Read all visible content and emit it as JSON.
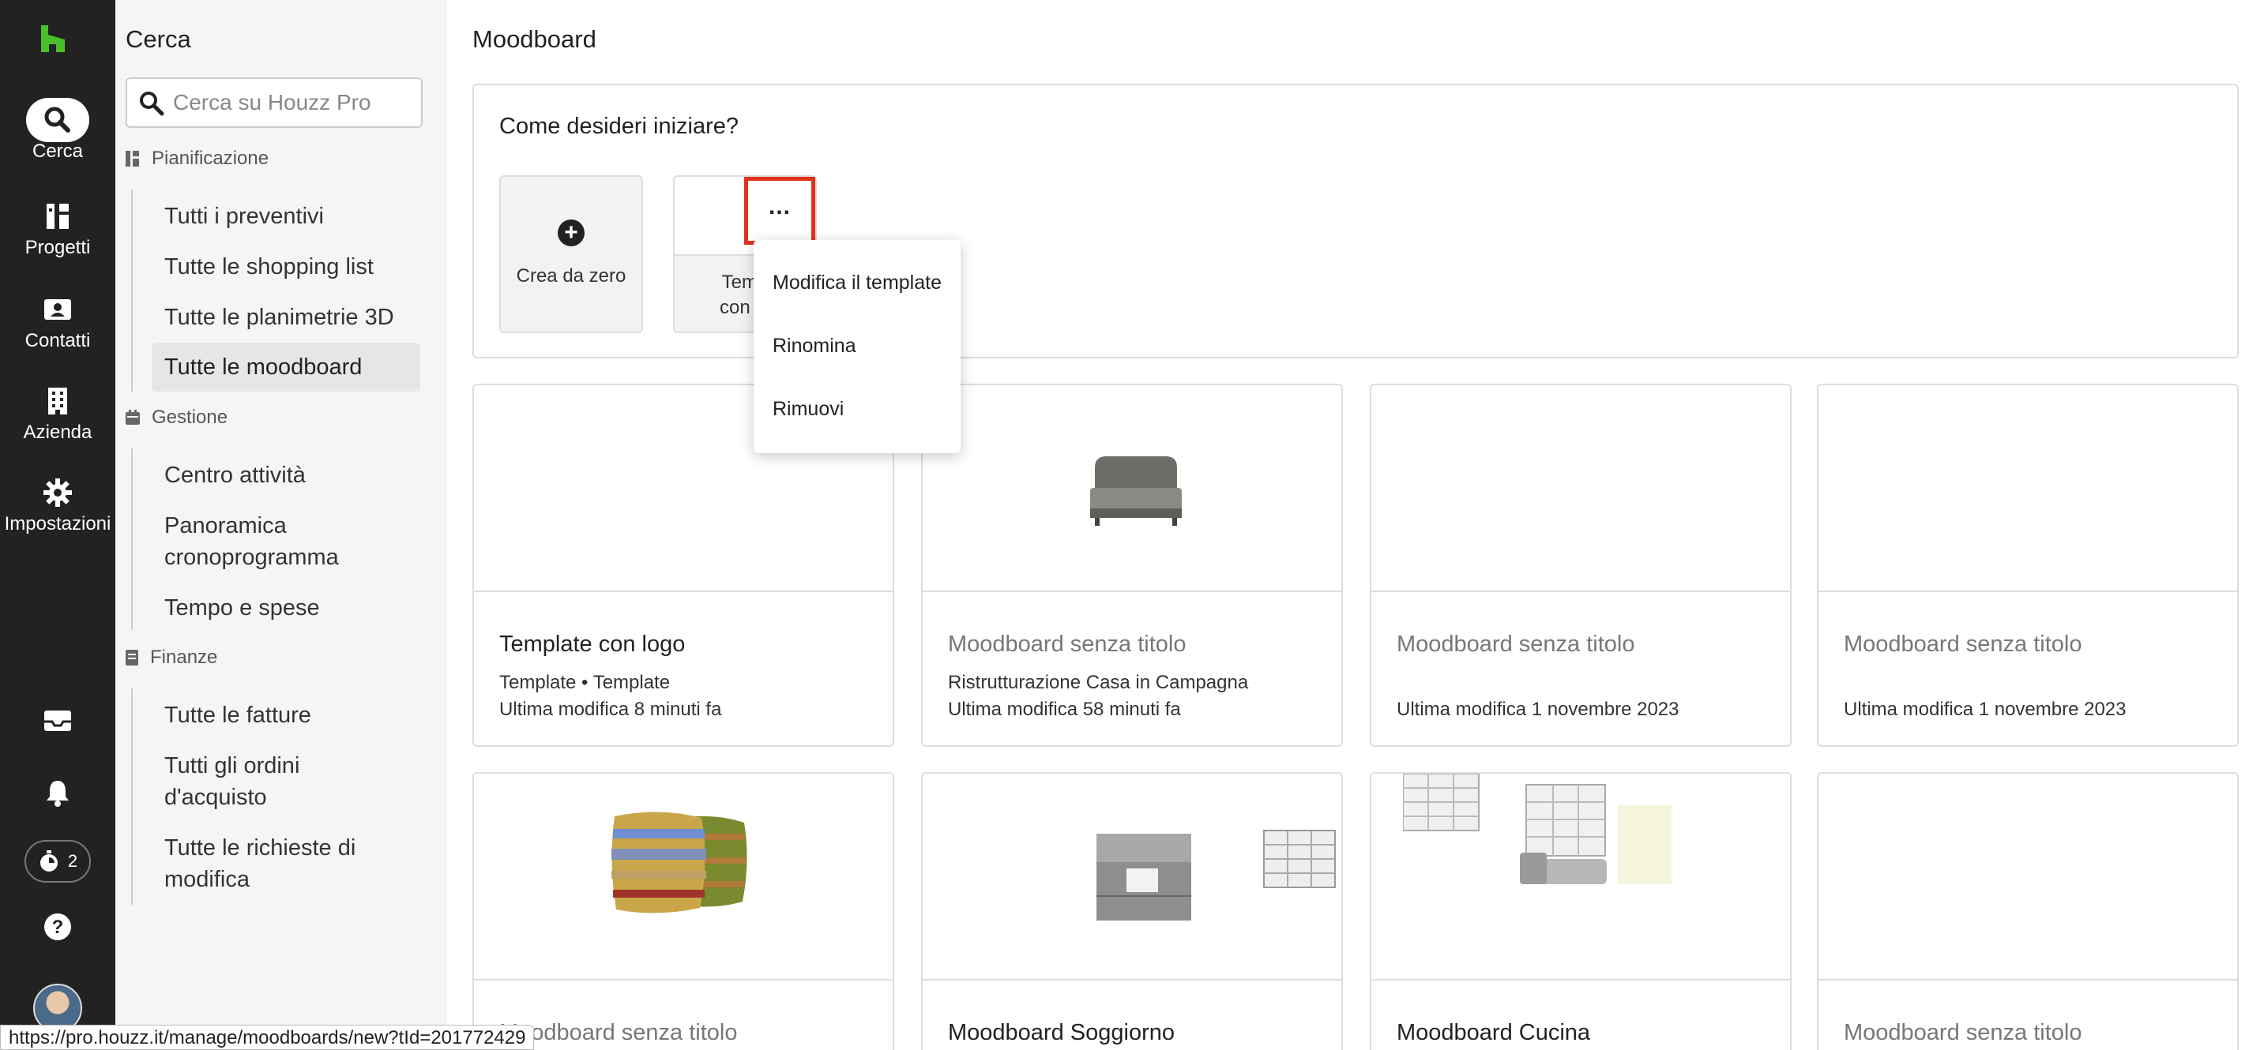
{
  "rail": {
    "items": [
      {
        "label": "Cerca",
        "icon": "search-icon"
      },
      {
        "label": "Progetti",
        "icon": "projects-icon"
      },
      {
        "label": "Contatti",
        "icon": "contacts-icon"
      },
      {
        "label": "Azienda",
        "icon": "building-icon"
      },
      {
        "label": "Impostazioni",
        "icon": "gear-icon"
      }
    ],
    "timer_count": "2"
  },
  "sidebar": {
    "title": "Cerca",
    "search_placeholder": "Cerca su Houzz Pro",
    "sections": [
      {
        "label": "Pianificazione",
        "links": [
          "Tutti i preventivi",
          "Tutte le shopping list",
          "Tutte le planimetrie 3D",
          "Tutte le moodboard"
        ]
      },
      {
        "label": "Gestione",
        "links": [
          "Centro attività",
          "Panoramica cronoprogramma",
          "Tempo e spese"
        ]
      },
      {
        "label": "Finanze",
        "links": [
          "Tutte le fatture",
          "Tutti gli ordini d'acquisto",
          "Tutte le richieste di modifica"
        ]
      }
    ],
    "active_link": "Tutte le moodboard"
  },
  "main": {
    "title": "Moodboard",
    "start_question": "Come desideri iniziare?",
    "new_tile_label": "Crea da zero",
    "template_tile_label_1": "Temp",
    "template_tile_label_2": "con lo",
    "more_button": "...",
    "menu": [
      "Modifica il template",
      "Rinomina",
      "Rimuovi"
    ],
    "cards": [
      {
        "title": "Template con logo",
        "line1": "Template • Template",
        "line2": "Ultima modifica 8 minuti fa"
      },
      {
        "title": "Moodboard senza titolo",
        "line1": "Ristrutturazione Casa in Campagna",
        "line2": "Ultima modifica 58 minuti fa"
      },
      {
        "title": "Moodboard senza titolo",
        "line1": "",
        "line2": "Ultima modifica 1 novembre 2023"
      },
      {
        "title": "Moodboard senza titolo",
        "line1": "",
        "line2": "Ultima modifica 1 novembre 2023"
      },
      {
        "title": "Moodboard senza titolo"
      },
      {
        "title": "Moodboard Soggiorno"
      },
      {
        "title": "Moodboard Cucina"
      },
      {
        "title": "Moodboard senza titolo"
      }
    ]
  },
  "status_url": "https://pro.houzz.it/manage/moodboards/new?tId=201772429",
  "colors": {
    "rail_bg": "#222222",
    "brand_green": "#4bbf2b",
    "highlight_red": "#e0321e"
  }
}
